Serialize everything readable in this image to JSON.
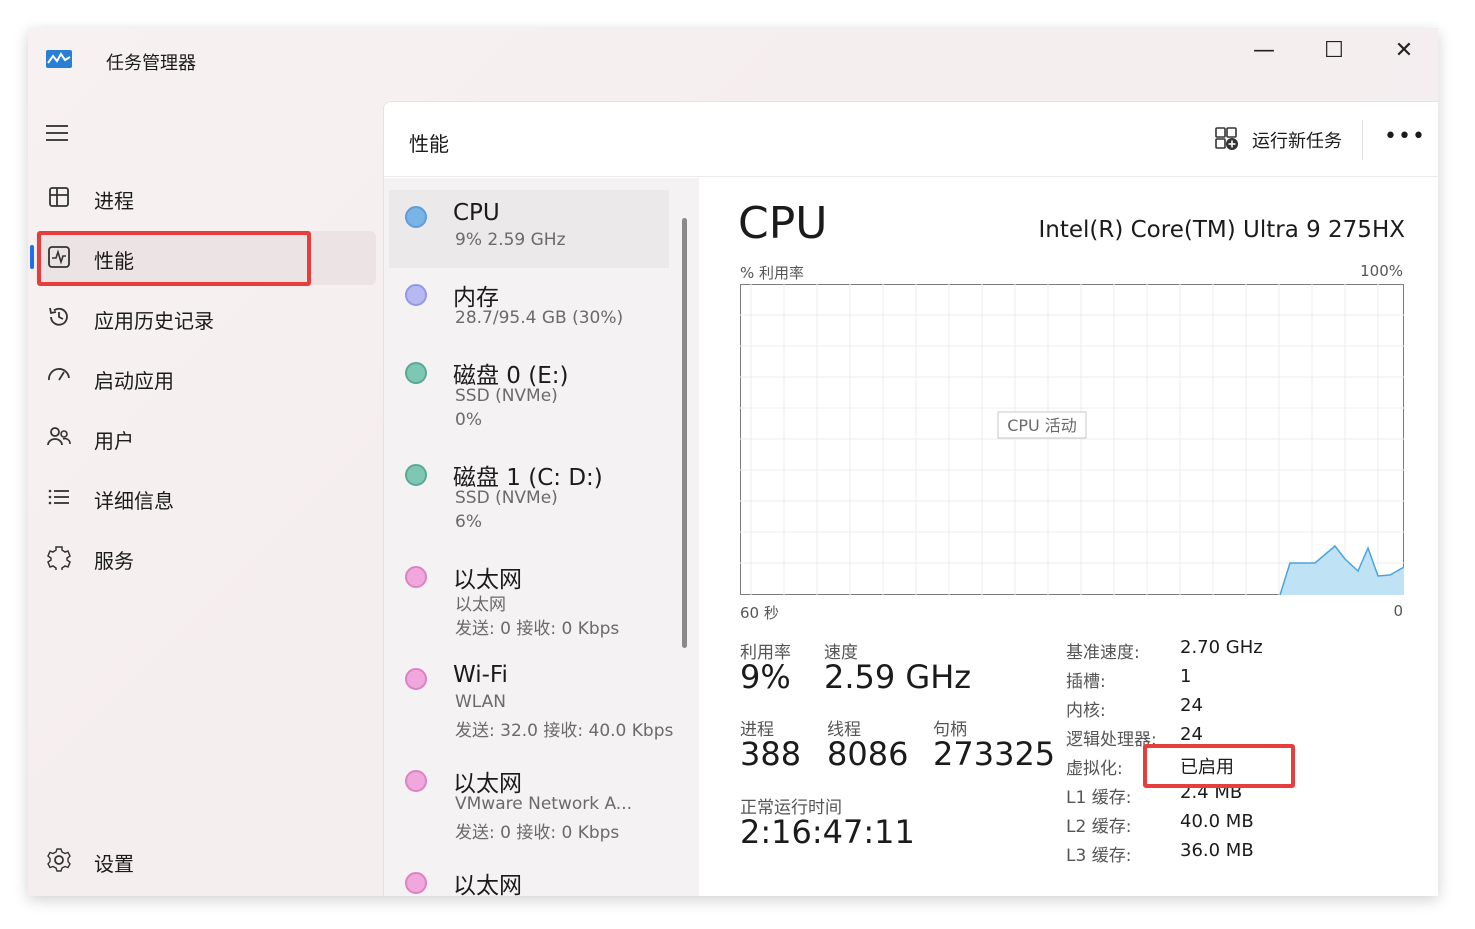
{
  "window": {
    "title": "任务管理器",
    "minimize": "—",
    "maximize": "☐",
    "close": "✕"
  },
  "nav": {
    "items": [
      {
        "label": "进程",
        "icon": "processes-icon"
      },
      {
        "label": "性能",
        "icon": "performance-icon",
        "active": true
      },
      {
        "label": "应用历史记录",
        "icon": "history-icon"
      },
      {
        "label": "启动应用",
        "icon": "startup-icon"
      },
      {
        "label": "用户",
        "icon": "users-icon"
      },
      {
        "label": "详细信息",
        "icon": "details-icon"
      },
      {
        "label": "服务",
        "icon": "services-icon"
      }
    ],
    "settings": "设置"
  },
  "header": {
    "title": "性能",
    "run_task": "运行新任务",
    "more": "•••"
  },
  "devices": [
    {
      "name": "CPU",
      "line1": "9%  2.59 GHz",
      "line2": "",
      "color": "#7ab3e6"
    },
    {
      "name": "内存",
      "line1": "28.7/95.4 GB (30%)",
      "line2": "",
      "color": "#b6b8f2"
    },
    {
      "name": "磁盘 0 (E:)",
      "line1": "SSD (NVMe)",
      "line2": "0%",
      "color": "#7fc7b5"
    },
    {
      "name": "磁盘 1 (C: D:)",
      "line1": "SSD (NVMe)",
      "line2": "6%",
      "color": "#7fc7b5"
    },
    {
      "name": "以太网",
      "line1": "以太网",
      "line2": "发送: 0  接收: 0 Kbps",
      "color": "#f0a8dc"
    },
    {
      "name": "Wi-Fi",
      "line1": "WLAN",
      "line2": "发送: 32.0  接收: 40.0 Kbps",
      "color": "#f0a8dc"
    },
    {
      "name": "以太网",
      "line1": "VMware Network A...",
      "line2": "发送: 0  接收: 0 Kbps",
      "color": "#f0a8dc"
    },
    {
      "name": "以太网",
      "line1": "",
      "line2": "",
      "color": "#f0a8dc"
    }
  ],
  "detail": {
    "title": "CPU",
    "model": "Intel(R) Core(TM) Ultra 9 275HX",
    "graph_ylabel": "% 利用率",
    "graph_ymax": "100%",
    "graph_tooltip": "CPU 活动",
    "graph_xleft": "60 秒",
    "graph_xright": "0",
    "utilization_label": "利用率",
    "utilization": "9%",
    "speed_label": "速度",
    "speed": "2.59 GHz",
    "processes_label": "进程",
    "processes": "388",
    "threads_label": "线程",
    "threads": "8086",
    "handles_label": "句柄",
    "handles": "273325",
    "uptime_label": "正常运行时间",
    "uptime": "2:16:47:11",
    "specs": [
      {
        "key": "基准速度:",
        "value": "2.70 GHz"
      },
      {
        "key": "插槽:",
        "value": "1"
      },
      {
        "key": "内核:",
        "value": "24"
      },
      {
        "key": "逻辑处理器:",
        "value": "24"
      },
      {
        "key": "虚拟化:",
        "value": "已启用"
      },
      {
        "key": "L1 缓存:",
        "value": "2.4 MB"
      },
      {
        "key": "L2 缓存:",
        "value": "40.0 MB"
      },
      {
        "key": "L3 缓存:",
        "value": "36.0 MB"
      }
    ]
  },
  "colors": {
    "accent": "#1d6ef0",
    "highlight": "#e83d3d",
    "cpu_graph_line": "#4aa3df",
    "cpu_graph_fill": "#bfe3f5"
  }
}
